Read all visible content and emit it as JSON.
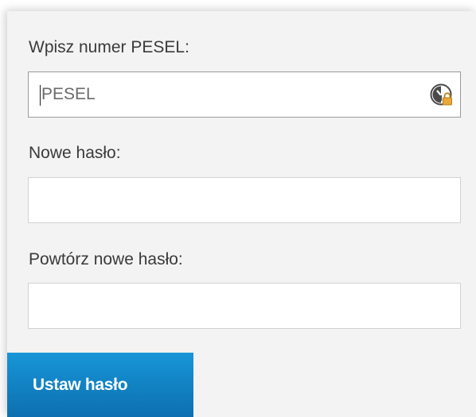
{
  "form": {
    "pesel": {
      "label": "Wpisz numer PESEL:",
      "placeholder": "PESEL",
      "value": ""
    },
    "new_password": {
      "label": "Nowe hasło:",
      "value": ""
    },
    "repeat_password": {
      "label": "Powtórz nowe hasło:",
      "value": ""
    },
    "submit_label": "Ustaw hasło"
  },
  "colors": {
    "button_top": "#1796d8",
    "button_bottom": "#0d6fb0",
    "card_background": "#f3f3f3",
    "label_text": "#3a3a3a"
  },
  "icons": {
    "pesel_field_icon": "password-manager-lock-icon"
  }
}
